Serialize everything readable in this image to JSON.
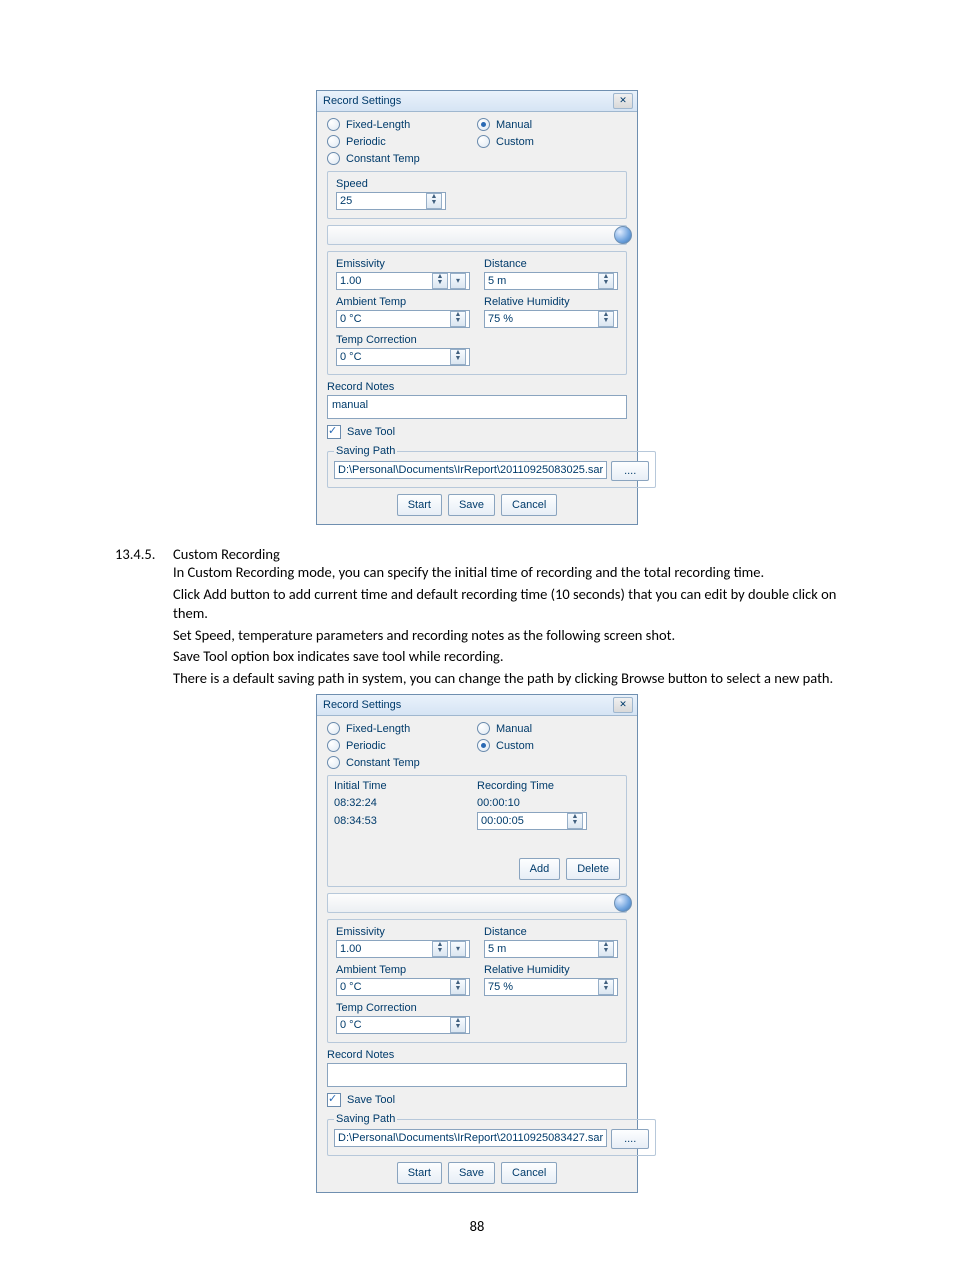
{
  "dialog1": {
    "title": "Record Settings",
    "radios": {
      "fixed_length": "Fixed-Length",
      "periodic": "Periodic",
      "constant_temp": "Constant Temp",
      "manual": "Manual",
      "custom": "Custom"
    },
    "selected": "manual",
    "speed_label": "Speed",
    "speed_value": "25",
    "emissivity_label": "Emissivity",
    "emissivity_value": "1.00",
    "distance_label": "Distance",
    "distance_value": "5 m",
    "ambient_label": "Ambient Temp",
    "ambient_value": "0 °C",
    "humidity_label": "Relative Humidity",
    "humidity_value": "75 %",
    "tempcorr_label": "Temp Correction",
    "tempcorr_value": "0 °C",
    "notes_label": "Record Notes",
    "notes_value": "manual",
    "save_tool_label": "Save Tool",
    "saving_path_label": "Saving Path",
    "saving_path_value": "D:\\Personal\\Documents\\IrReport\\20110925083025.sar",
    "browse": "....",
    "start": "Start",
    "save": "Save",
    "cancel": "Cancel"
  },
  "section": {
    "number": "13.4.5.",
    "title": "Custom Recording",
    "p1": "In Custom Recording mode, you can specify the initial time of recording and the total recording time.",
    "p2": "Click Add button to add current time and default recording time (10 seconds) that you can edit by double click on them.",
    "p3": "Set Speed, temperature parameters and recording notes as the following screen shot.",
    "p4": "Save Tool option box indicates save tool while recording.",
    "p5": "There is a default saving path in system, you can change the path by clicking Browse button to select a new path."
  },
  "dialog2": {
    "title": "Record Settings",
    "radios": {
      "fixed_length": "Fixed-Length",
      "periodic": "Periodic",
      "constant_temp": "Constant Temp",
      "manual": "Manual",
      "custom": "Custom"
    },
    "selected": "custom",
    "table": {
      "col1": "Initial Time",
      "col2": "Recording Time",
      "rows": [
        {
          "initial": "08:32:24",
          "recording": "00:00:10"
        },
        {
          "initial": "08:34:53",
          "recording": "00:00:05"
        }
      ],
      "add": "Add",
      "delete": "Delete"
    },
    "emissivity_label": "Emissivity",
    "emissivity_value": "1.00",
    "distance_label": "Distance",
    "distance_value": "5 m",
    "ambient_label": "Ambient Temp",
    "ambient_value": "0 °C",
    "humidity_label": "Relative Humidity",
    "humidity_value": "75 %",
    "tempcorr_label": "Temp Correction",
    "tempcorr_value": "0 °C",
    "notes_label": "Record Notes",
    "notes_value": "",
    "save_tool_label": "Save Tool",
    "saving_path_label": "Saving Path",
    "saving_path_value": "D:\\Personal\\Documents\\IrReport\\20110925083427.sar",
    "browse": "....",
    "start": "Start",
    "save": "Save",
    "cancel": "Cancel"
  },
  "page_number": "88"
}
